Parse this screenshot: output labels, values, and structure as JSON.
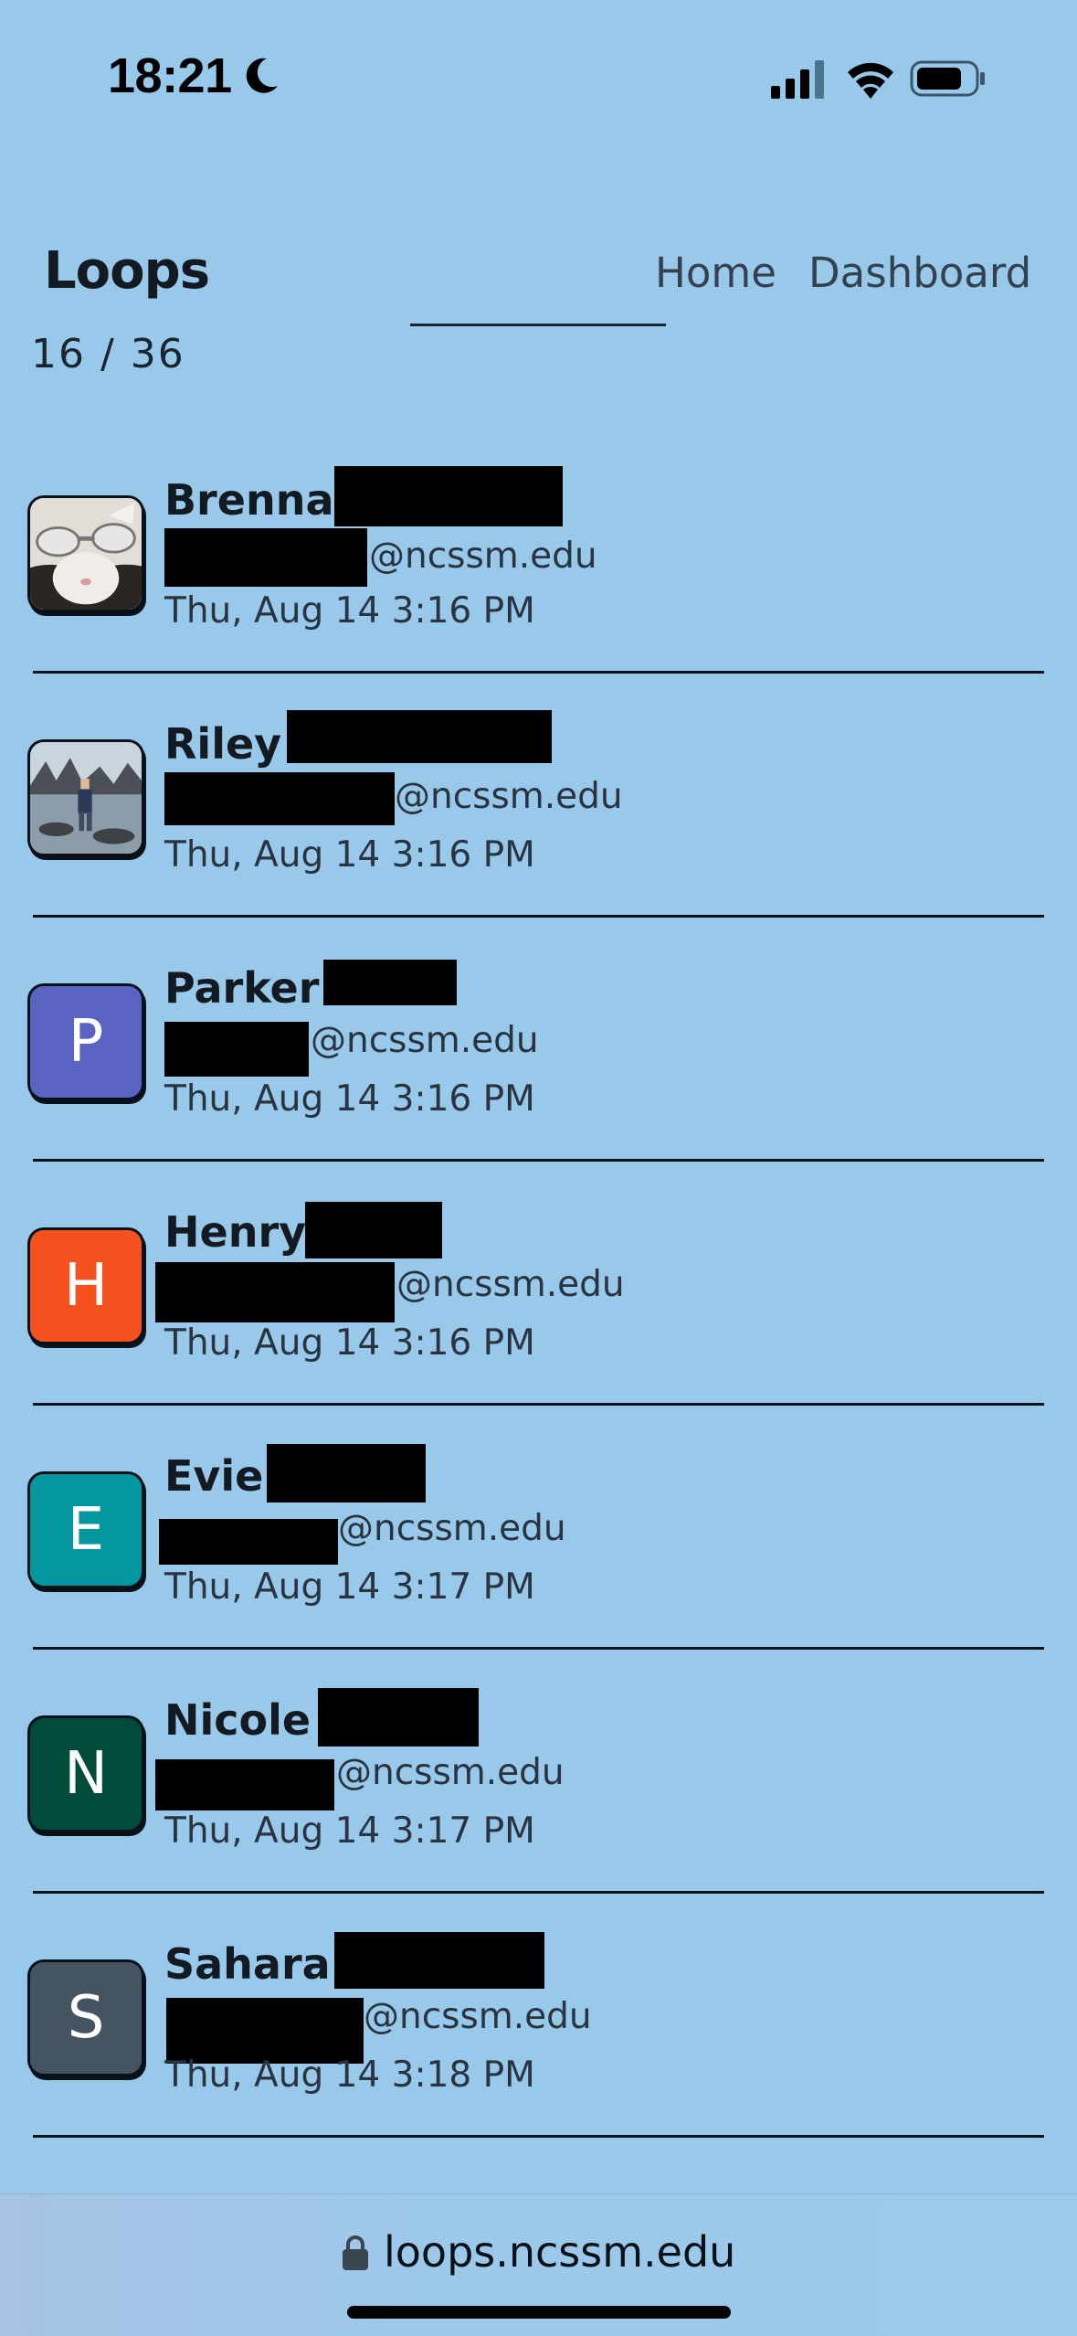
{
  "status_bar": {
    "time": "18:21"
  },
  "header": {
    "logo": "Loops",
    "nav": {
      "home": "Home",
      "dashboard": "Dashboard"
    },
    "counter": "16 / 36"
  },
  "people": [
    {
      "first_name": "Brenna",
      "email_domain": "@ncssm.edu",
      "timestamp": "Thu, Aug 14 3:16 PM",
      "avatar": {
        "type": "photo",
        "subject": "cat with sunglasses"
      }
    },
    {
      "first_name": "Riley",
      "email_domain": "@ncssm.edu",
      "timestamp": "Thu, Aug 14 3:16 PM",
      "avatar": {
        "type": "photo",
        "subject": "person standing in tide pool"
      }
    },
    {
      "first_name": "Parker",
      "email_domain": "@ncssm.edu",
      "timestamp": "Thu, Aug 14 3:16 PM",
      "avatar": {
        "type": "initial",
        "letter": "P",
        "color": "#5b63c2"
      }
    },
    {
      "first_name": "Henry",
      "email_domain": "@ncssm.edu",
      "timestamp": "Thu, Aug 14 3:16 PM",
      "avatar": {
        "type": "initial",
        "letter": "H",
        "color": "#f4511e"
      }
    },
    {
      "first_name": "Evie",
      "email_domain": "@ncssm.edu",
      "timestamp": "Thu, Aug 14 3:17 PM",
      "avatar": {
        "type": "initial",
        "letter": "E",
        "color": "#05979f"
      }
    },
    {
      "first_name": "Nicole",
      "email_domain": "@ncssm.edu",
      "timestamp": "Thu, Aug 14 3:17 PM",
      "avatar": {
        "type": "initial",
        "letter": "N",
        "color": "#004b3a"
      }
    },
    {
      "first_name": "Sahara",
      "email_domain": "@ncssm.edu",
      "timestamp": "Thu, Aug 14 3:18 PM",
      "avatar": {
        "type": "initial",
        "letter": "S",
        "color": "#445561"
      }
    }
  ],
  "browser": {
    "url": "loops.ncssm.edu"
  },
  "colors": {
    "background": "#99c9ea",
    "text": "#141a22",
    "divider": "#0b1118"
  }
}
